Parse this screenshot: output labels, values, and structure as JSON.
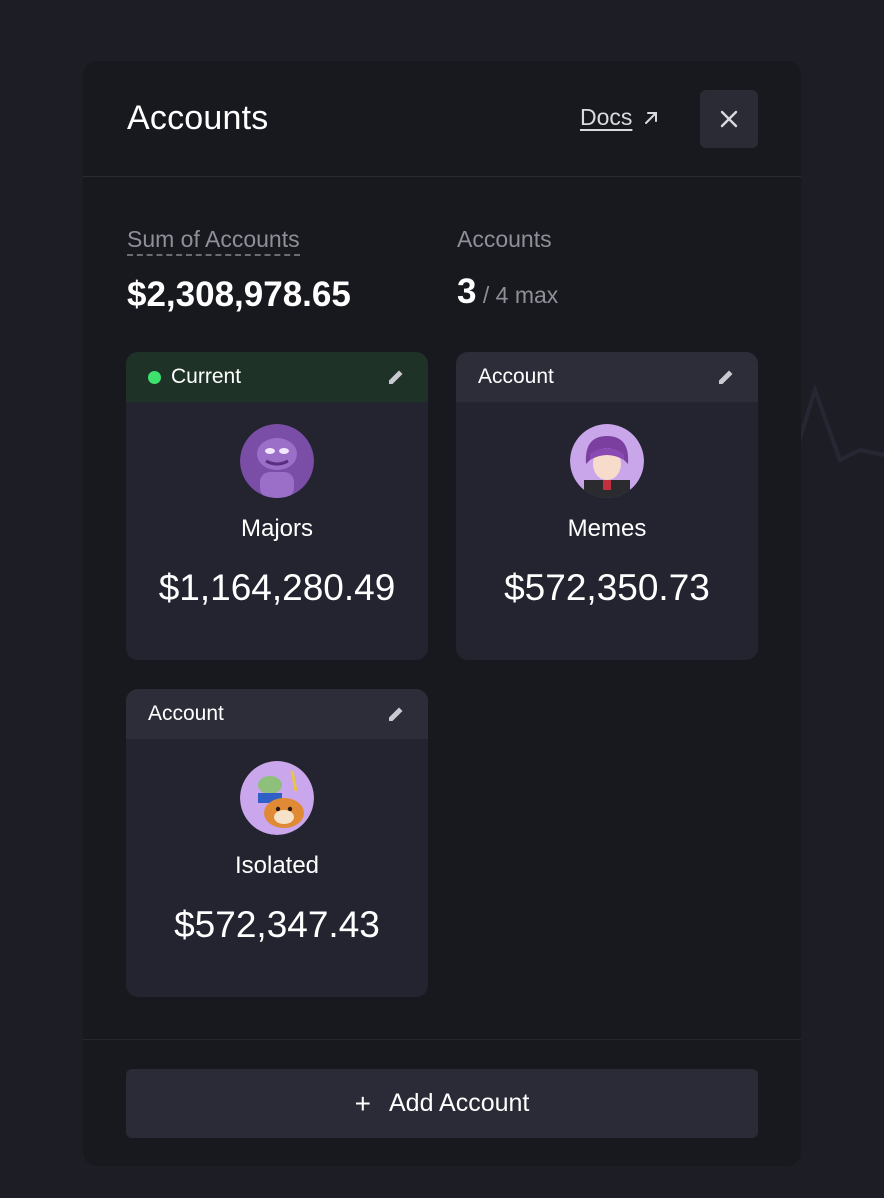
{
  "modal": {
    "title": "Accounts",
    "docs_label": "Docs"
  },
  "summary": {
    "sum_label": "Sum of Accounts",
    "sum_value": "$2,308,978.65",
    "accounts_label": "Accounts",
    "accounts_count": "3",
    "accounts_max": " / 4 max"
  },
  "accounts": [
    {
      "header": "Current",
      "is_current": true,
      "name": "Majors",
      "balance": "$1,164,280.49",
      "avatar": "pepe-avatar"
    },
    {
      "header": "Account",
      "is_current": false,
      "name": "Memes",
      "balance": "$572,350.73",
      "avatar": "anime-avatar"
    },
    {
      "header": "Account",
      "is_current": false,
      "name": "Isolated",
      "balance": "$572,347.43",
      "avatar": "pepe-doge-avatar"
    }
  ],
  "add_button": {
    "label": "Add Account"
  },
  "colors": {
    "modal_bg": "#18191e",
    "card_bg": "#232430",
    "current_header": "#1f3227",
    "status_green": "#3ee06e"
  }
}
